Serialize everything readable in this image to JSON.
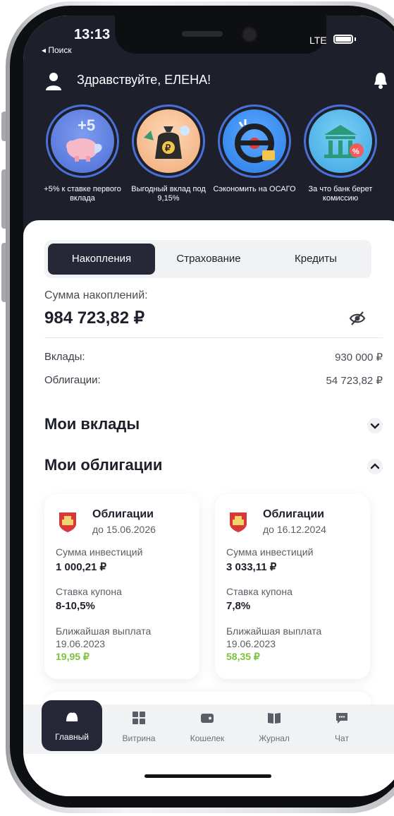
{
  "status_bar": {
    "time": "13:13",
    "back_label": "◂ Поиск",
    "network": "LTE"
  },
  "header": {
    "greeting": "Здравствуйте, ЕЛЕНА!",
    "user_icon": "user-icon",
    "bell_icon": "bell-icon"
  },
  "stories": [
    {
      "caption": "+5% к ставке первого вклада",
      "icon": "piggy-bank-icon",
      "bg": "#5a7ee6"
    },
    {
      "caption": "Выгодный вклад под 9,15%",
      "icon": "money-bag-icon",
      "bg": "#f2b98c"
    },
    {
      "caption": "Сэкономить на ОСАГО",
      "icon": "steering-wheel-icon",
      "bg": "#3d8ef0"
    },
    {
      "caption": "За что банк берет комиссию",
      "icon": "bank-icon",
      "bg": "#49b0e8"
    }
  ],
  "segments": {
    "tabs": [
      "Накопления",
      "Страхование",
      "Кредиты"
    ],
    "active": "Накопления"
  },
  "summary": {
    "label": "Сумма накоплений:",
    "value": "984 723,82 ₽",
    "deposits_label": "Вклады:",
    "deposits_value": "930 000 ₽",
    "bonds_label": "Облигации:",
    "bonds_value": "54 723,82 ₽"
  },
  "sections": {
    "deposits_title": "Мои вклады",
    "bonds_title": "Мои облигации"
  },
  "bond_cards": [
    {
      "title": "Облигации",
      "until": "до 15.06.2026",
      "invest_label": "Сумма инвестиций",
      "invest_value": "1 000,21 ₽",
      "coupon_label": "Ставка купона",
      "coupon_value": "8-10,5%",
      "payout_label": "Ближайшая выплата",
      "payout_date": "19.06.2023",
      "payout_value": "19,95 ₽"
    },
    {
      "title": "Облигации",
      "until": "до 16.12.2024",
      "invest_label": "Сумма инвестиций",
      "invest_value": "3 033,11 ₽",
      "coupon_label": "Ставка купона",
      "coupon_value": "7,8%",
      "payout_label": "Ближайшая выплата",
      "payout_date": "19.06.2023",
      "payout_value": "58,35 ₽"
    }
  ],
  "tabbar": [
    {
      "label": "Главный",
      "icon": "home-icon",
      "active": true
    },
    {
      "label": "Витрина",
      "icon": "grid-icon",
      "active": false
    },
    {
      "label": "Кошелек",
      "icon": "wallet-icon",
      "active": false
    },
    {
      "label": "Журнал",
      "icon": "book-icon",
      "active": false
    },
    {
      "label": "Чат",
      "icon": "chat-icon",
      "active": false
    }
  ],
  "colors": {
    "dark": "#1d1f2b",
    "active_tab": "#262837",
    "accent_green": "#7ac23e",
    "ring_blue": "#4a6fd6"
  }
}
